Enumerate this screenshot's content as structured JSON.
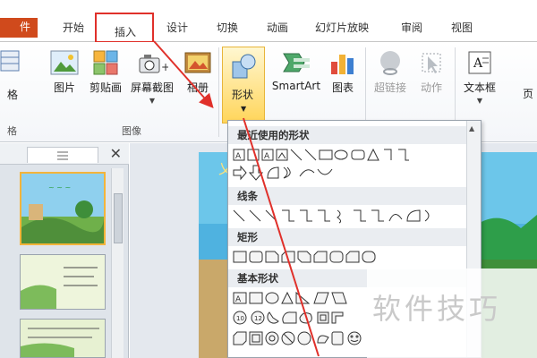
{
  "tabs": {
    "file": "件",
    "home": "开始",
    "insert": "插入",
    "design": "设计",
    "transitions": "切换",
    "animations": "动画",
    "slideshow": "幻灯片放映",
    "review": "审阅",
    "view": "视图"
  },
  "ribbon": {
    "partial_left_label": "格",
    "picture": "图片",
    "clipart": "剪贴画",
    "screenshot": "屏幕截图",
    "album": "相册",
    "shapes": "形状",
    "smartart": "SmartArt",
    "chart": "图表",
    "hyperlink": "超链接",
    "action": "动作",
    "textbox": "文本框",
    "partial_right_label": "页",
    "group_images": "图像",
    "group_partial_left": "格"
  },
  "dropdown": {
    "recent_header": "最近使用的形状",
    "lines_header": "线条",
    "rect_header": "矩形",
    "basic_header": "基本形状"
  },
  "watermark": "软件技巧",
  "colors": {
    "highlight_red": "#e0302a",
    "file_tab": "#d04a1c",
    "shapes_button": "#ffd55a"
  },
  "icons": [
    "picture-icon",
    "clipart-icon",
    "screenshot-icon",
    "album-icon",
    "shapes-icon",
    "smartart-icon",
    "chart-icon",
    "hyperlink-icon",
    "action-icon",
    "textbox-icon"
  ]
}
